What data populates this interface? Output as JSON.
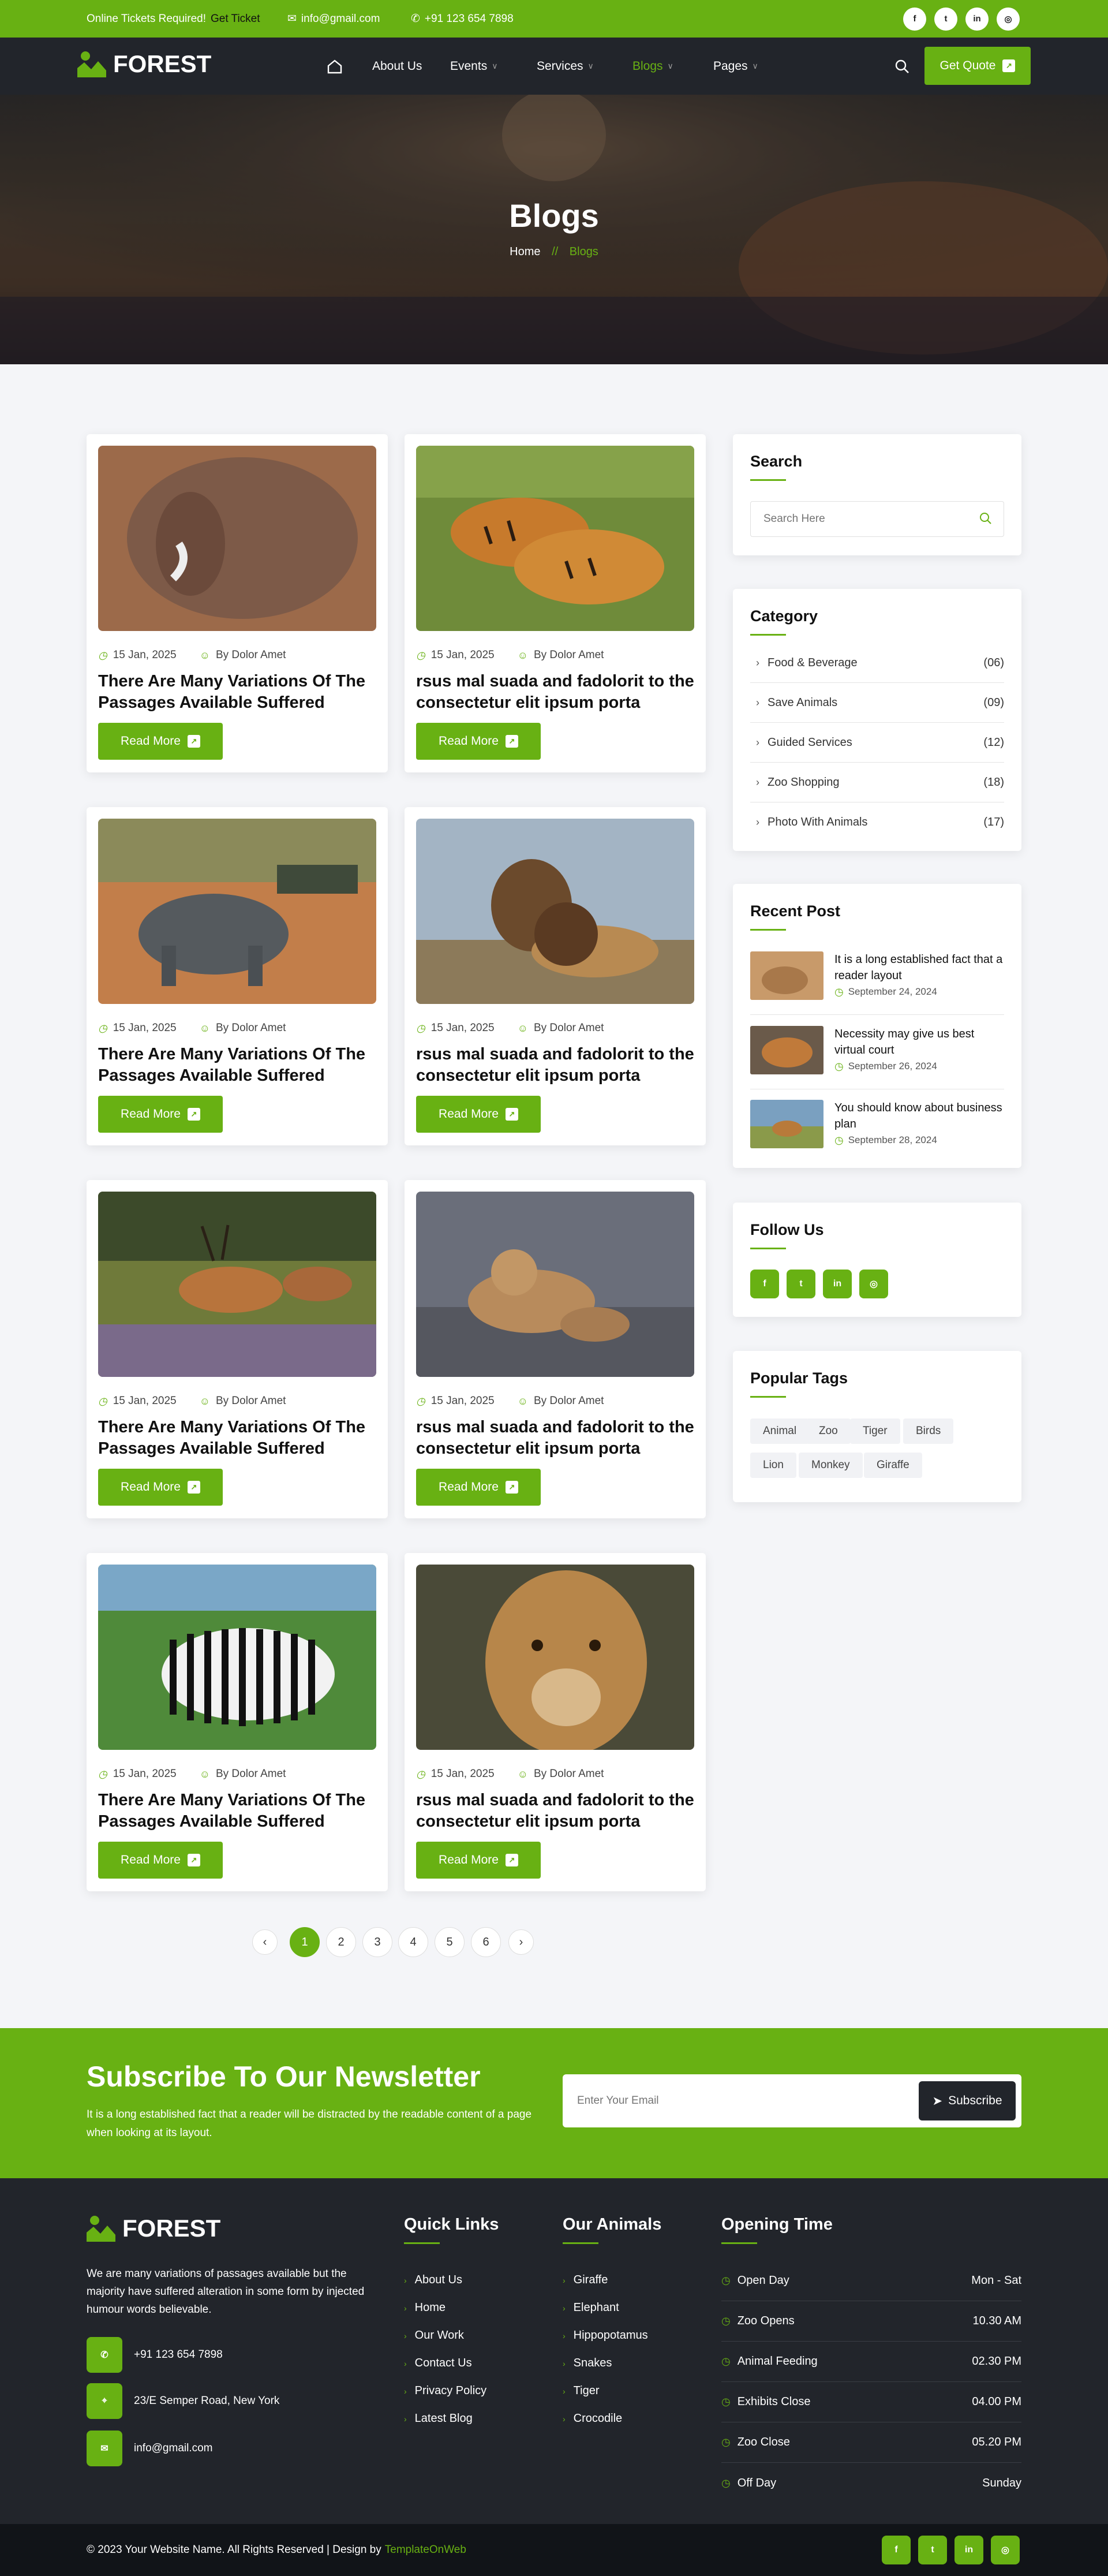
{
  "topbar": {
    "tickets_text": "Online Tickets Required!",
    "tickets_link": "Get Ticket",
    "email": "info@gmail.com",
    "phone": "+91 123 654 7898",
    "social": [
      "facebook-icon",
      "twitter-icon",
      "linkedin-icon",
      "instagram-icon"
    ]
  },
  "nav": {
    "logo": "FOREST",
    "items": [
      {
        "label": "About Us"
      },
      {
        "label": "Events"
      },
      {
        "label": "Services"
      },
      {
        "label": "Blogs"
      },
      {
        "label": "Pages"
      }
    ],
    "cta": "Get Quote"
  },
  "hero": {
    "title": "Blogs",
    "crumb_home": "Home",
    "crumb_sep": "//",
    "crumb_current": "Blogs"
  },
  "posts": [
    {
      "date": "15 Jan, 2025",
      "author": "By Dolor Amet",
      "title": "There Are Many Variations Of The Passages Available Suffered",
      "button": "Read More"
    },
    {
      "date": "15 Jan, 2025",
      "author": "By Dolor Amet",
      "title": "rsus mal suada and fadolorit to the consectetur elit ipsum porta",
      "button": "Read More"
    },
    {
      "date": "15 Jan, 2025",
      "author": "By Dolor Amet",
      "title": "There Are Many Variations Of The Passages Available Suffered",
      "button": "Read More"
    },
    {
      "date": "15 Jan, 2025",
      "author": "By Dolor Amet",
      "title": "rsus mal suada and fadolorit to the consectetur elit ipsum porta",
      "button": "Read More"
    },
    {
      "date": "15 Jan, 2025",
      "author": "By Dolor Amet",
      "title": "There Are Many Variations Of The Passages Available Suffered",
      "button": "Read More"
    },
    {
      "date": "15 Jan, 2025",
      "author": "By Dolor Amet",
      "title": "rsus mal suada and fadolorit to the consectetur elit ipsum porta",
      "button": "Read More"
    },
    {
      "date": "15 Jan, 2025",
      "author": "By Dolor Amet",
      "title": "There Are Many Variations Of The Passages Available Suffered",
      "button": "Read More"
    },
    {
      "date": "15 Jan, 2025",
      "author": "By Dolor Amet",
      "title": "rsus mal suada and fadolorit to the consectetur elit ipsum porta",
      "button": "Read More"
    }
  ],
  "pagination": {
    "prev": "‹",
    "pages": [
      "1",
      "2",
      "3",
      "4",
      "5",
      "6"
    ],
    "next": "›",
    "active": "1"
  },
  "sidebar": {
    "search": {
      "title": "Search",
      "placeholder": "Search Here"
    },
    "category": {
      "title": "Category",
      "items": [
        {
          "label": "Food & Beverage",
          "count": "(06)"
        },
        {
          "label": "Save Animals",
          "count": "(09)"
        },
        {
          "label": "Guided Services",
          "count": "(12)"
        },
        {
          "label": "Zoo Shopping",
          "count": "(18)"
        },
        {
          "label": "Photo With Animals",
          "count": "(17)"
        }
      ]
    },
    "recent": {
      "title": "Recent Post",
      "items": [
        {
          "title": "It is a long established fact that a reader layout",
          "date": "September 24, 2024"
        },
        {
          "title": "Necessity may give us best virtual court",
          "date": "September 26, 2024"
        },
        {
          "title": "You should know about business plan",
          "date": "September 28, 2024"
        }
      ]
    },
    "follow": {
      "title": "Follow Us"
    },
    "tags": {
      "title": "Popular Tags",
      "items": [
        "Animal",
        "Zoo",
        "Tiger",
        "Birds",
        "Lion",
        "Monkey",
        "Giraffe"
      ]
    }
  },
  "newsletter": {
    "title": "Subscribe To Our Newsletter",
    "text": "It is a long established fact that a reader will be distracted by the readable content of a page when looking at its layout.",
    "placeholder": "Enter Your Email",
    "button": "Subscribe"
  },
  "footer": {
    "logo": "FOREST",
    "about": "We are many variations of passages available but the majority have suffered alteration in some form by injected humour words believable.",
    "phone": "+91 123 654 7898",
    "address": "23/E Semper Road, New York",
    "email": "info@gmail.com",
    "quick_title": "Quick Links",
    "quick_links": [
      "About Us",
      "Home",
      "Our Work",
      "Contact Us",
      "Privacy Policy",
      "Latest Blog"
    ],
    "animals_title": "Our Animals",
    "animals": [
      "Giraffe",
      "Elephant",
      "Hippopotamus",
      "Snakes",
      "Tiger",
      "Crocodile"
    ],
    "opening_title": "Opening Time",
    "opening": [
      {
        "label": "Open Day",
        "value": "Mon - Sat"
      },
      {
        "label": "Zoo Opens",
        "value": "10.30 AM"
      },
      {
        "label": "Animal Feeding",
        "value": "02.30 PM"
      },
      {
        "label": "Exhibits Close",
        "value": "04.00 PM"
      },
      {
        "label": "Zoo Close",
        "value": "05.20 PM"
      },
      {
        "label": "Off Day",
        "value": "Sunday"
      }
    ]
  },
  "copyright": {
    "text": "© 2023 Your Website Name. All Rights Reserved | Design by",
    "link": "TemplateOnWeb"
  },
  "colors": {
    "accent": "#68b113",
    "dark": "#22252b",
    "darker": "#111418"
  }
}
